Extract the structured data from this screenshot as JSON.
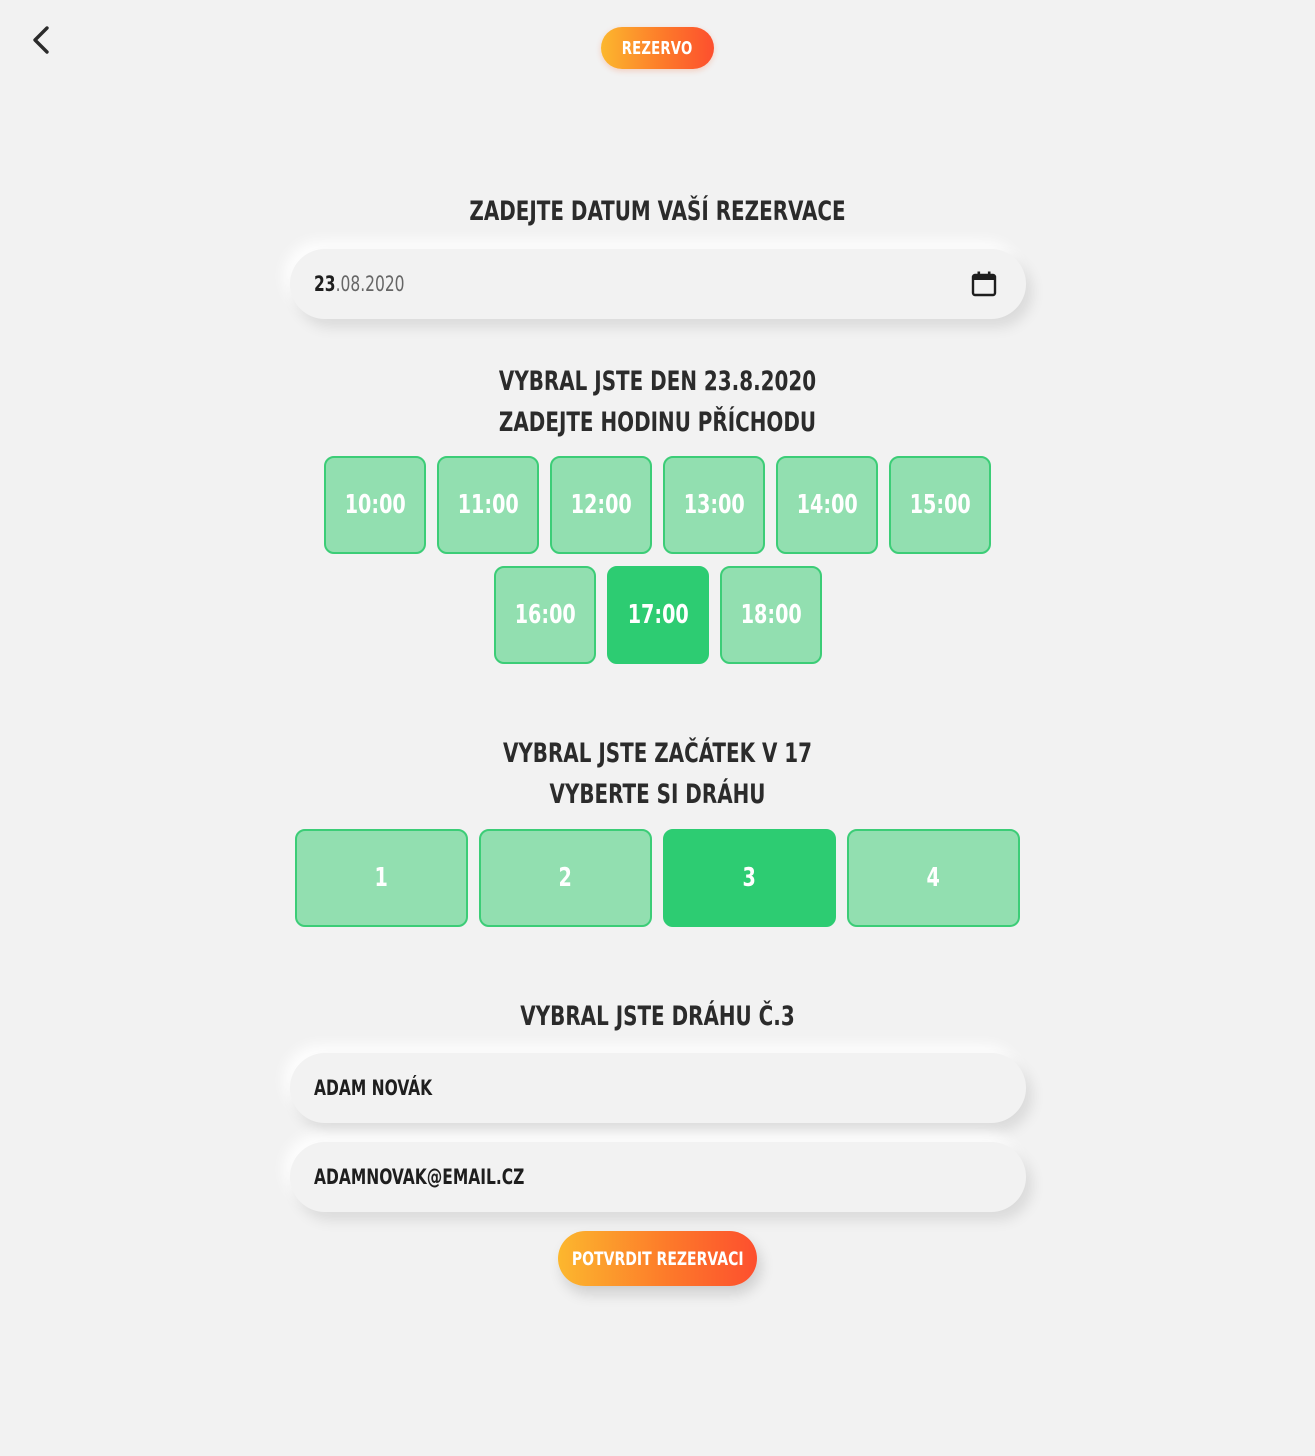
{
  "header": {
    "back_icon": "chevron-left-icon",
    "logo_label": "REZERVO"
  },
  "date_section": {
    "heading": "ZADEJTE DATUM VAŠÍ REZERVACE",
    "date_day": "23",
    "date_rest": ".08.2020",
    "calendar_icon": "calendar-icon"
  },
  "time_section": {
    "heading_line1": "VYBRAL JSTE DEN 23.8.2020",
    "heading_line2": "ZADEJTE HODINU PŘÍCHODU",
    "slots": [
      "10:00",
      "11:00",
      "12:00",
      "13:00",
      "14:00",
      "15:00",
      "16:00",
      "17:00",
      "18:00"
    ],
    "selected": "17:00"
  },
  "lane_section": {
    "heading_line1": "VYBRAL JSTE ZAČÁTEK V 17",
    "heading_line2": "VYBERTE SI DRÁHU",
    "lanes": [
      "1",
      "2",
      "3",
      "4"
    ],
    "selected": "3"
  },
  "contact_section": {
    "heading": "VYBRAL JSTE DRÁHU Č.3",
    "name_value": "ADAM NOVÁK",
    "email_value": "ADAMNOVAK@EMAIL.CZ"
  },
  "submit_label": "POTVRDIT REZERVACI",
  "colors": {
    "slot_bg": "#92dfb0",
    "slot_border": "#3ccd77",
    "slot_selected": "#2dcc72",
    "accent_gradient_start": "#fcb72e",
    "accent_gradient_end": "#fd4f2e"
  }
}
